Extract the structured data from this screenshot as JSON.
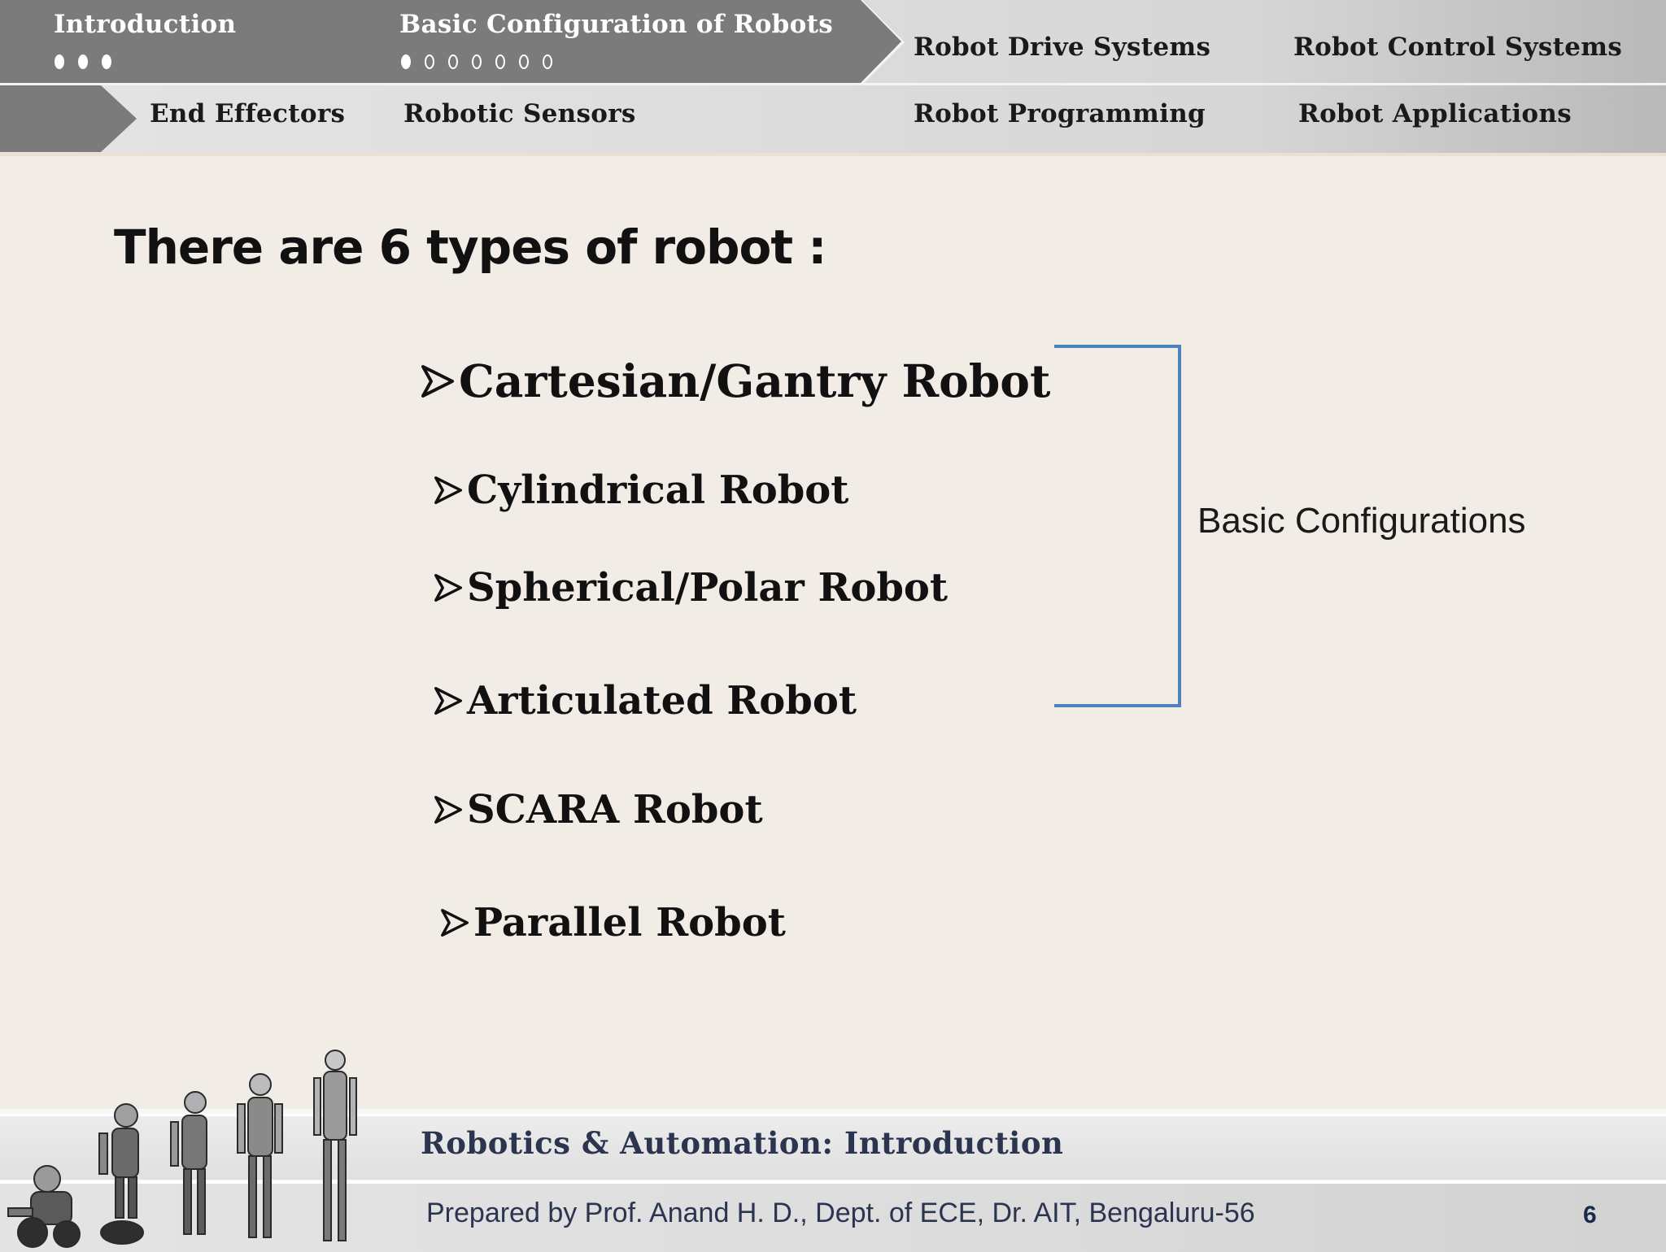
{
  "nav": {
    "sections": [
      {
        "label": "Introduction",
        "state": "active",
        "dots_filled": 3,
        "dots_hollow": 0
      },
      {
        "label": "Basic Configuration of Robots",
        "state": "active",
        "dots_filled": 1,
        "dots_hollow": 6
      },
      {
        "label": "Robot Drive Systems",
        "state": "inactive"
      },
      {
        "label": "Robot Control Systems",
        "state": "inactive"
      },
      {
        "label": "End Effectors",
        "state": "inactive"
      },
      {
        "label": "Robotic Sensors",
        "state": "inactive"
      },
      {
        "label": "Robot Programming",
        "state": "inactive"
      },
      {
        "label": "Robot Applications",
        "state": "inactive"
      }
    ]
  },
  "slide": {
    "title": "There are 6 types of robot :",
    "items": [
      "Cartesian/Gantry Robot",
      "Cylindrical Robot",
      "Spherical/Polar Robot",
      "Articulated Robot",
      "SCARA Robot",
      "Parallel Robot"
    ],
    "bracket_label": "Basic Configurations",
    "bracket_color": "#4f80bd"
  },
  "footer": {
    "course_title": "Robotics & Automation: Introduction",
    "credit": "Prepared by Prof. Anand H. D., Dept. of ECE,  Dr. AIT, Bengaluru-56",
    "page_number": "6",
    "image": "robot-evolution-graphic"
  }
}
